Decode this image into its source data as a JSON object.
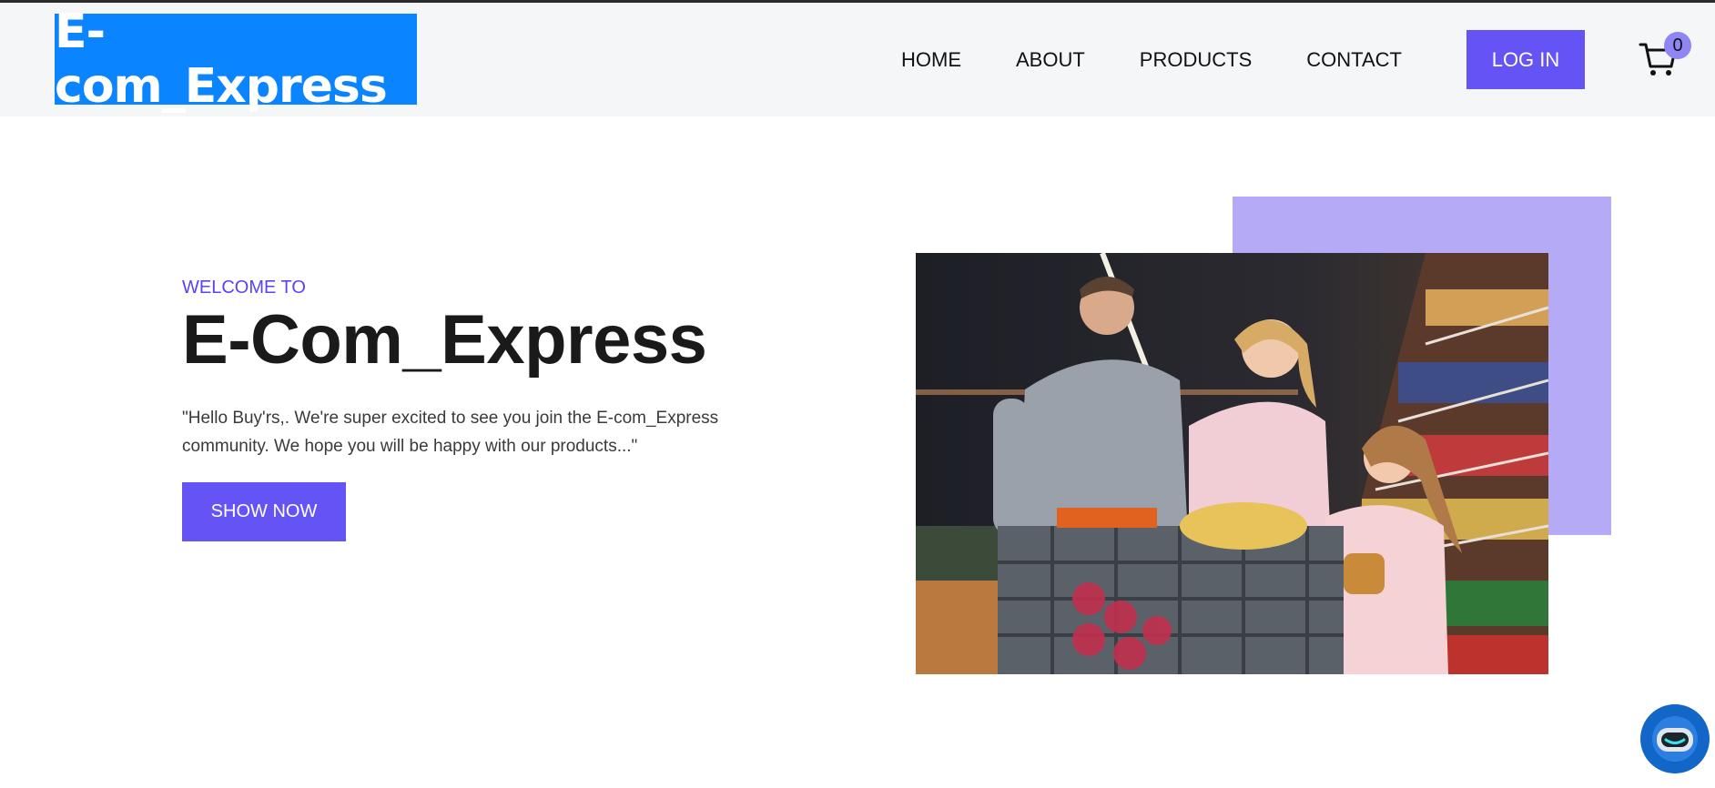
{
  "header": {
    "logo_text": "E-com_Express",
    "nav": [
      {
        "label": "HOME"
      },
      {
        "label": "ABOUT"
      },
      {
        "label": "PRODUCTS"
      },
      {
        "label": "CONTACT"
      }
    ],
    "login_label": "LOG IN",
    "cart_count": "0"
  },
  "hero": {
    "eyebrow": "WELCOME TO",
    "title": "E-Com_Express",
    "description": "\"Hello Buy'rs,. We're super excited to see you join the E-com_Express community. We hope you will be happy with our products...\"",
    "cta_label": "SHOW NOW"
  },
  "colors": {
    "logo_bg": "#0b84ff",
    "accent": "#6453f5",
    "accent_light": "#b5aaf5",
    "header_bg": "#f5f6f8",
    "chat_bg": "#1166c8"
  },
  "icons": {
    "cart": "shopping-cart-icon",
    "chat": "chatbot-icon"
  }
}
